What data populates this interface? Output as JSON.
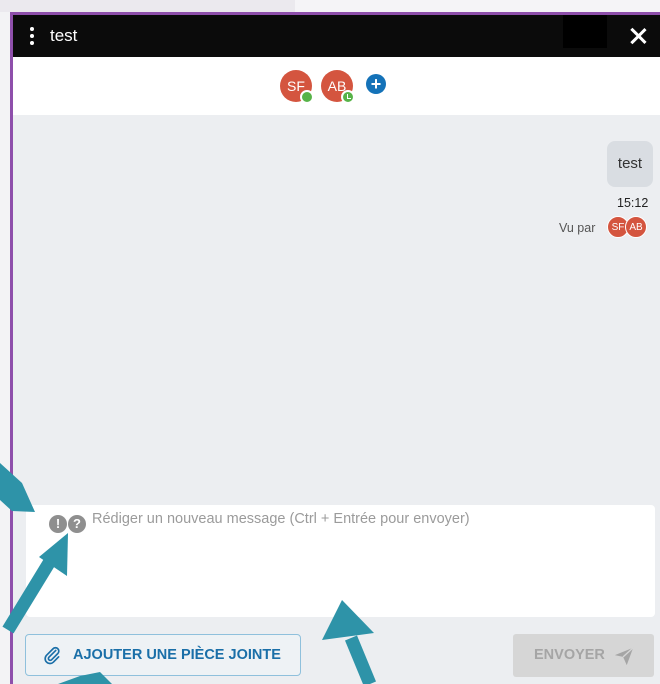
{
  "window": {
    "title": "test",
    "menu_icon": "vertical-dots-icon",
    "close_icon": "close-icon"
  },
  "participants": [
    {
      "initials": "SF",
      "status": "online",
      "status_color": "#57b348"
    },
    {
      "initials": "AB",
      "status": "away-clock",
      "status_color": "#57b348"
    }
  ],
  "add_participant_icon": "plus-circle-icon",
  "conversation": {
    "messages": [
      {
        "text": "test",
        "time": "15:12",
        "seen_label": "Vu par",
        "seen_by": [
          "SF",
          "AB"
        ]
      }
    ]
  },
  "composer": {
    "warning_icon": "exclamation-circle-icon",
    "help_icon": "question-circle-icon",
    "placeholder": "Rédiger un nouveau message (Ctrl + Entrée pour envoyer)",
    "value": ""
  },
  "actions": {
    "attach_label": "AJOUTER UNE PIÈCE JOINTE",
    "attach_icon": "paperclip-icon",
    "send_label": "ENVOYER",
    "send_icon": "paper-plane-icon"
  },
  "colors": {
    "accent": "#8e4fab",
    "avatar": "#d4553f",
    "link_blue": "#1a6fa8",
    "annotation_arrow": "#2e93a8"
  }
}
